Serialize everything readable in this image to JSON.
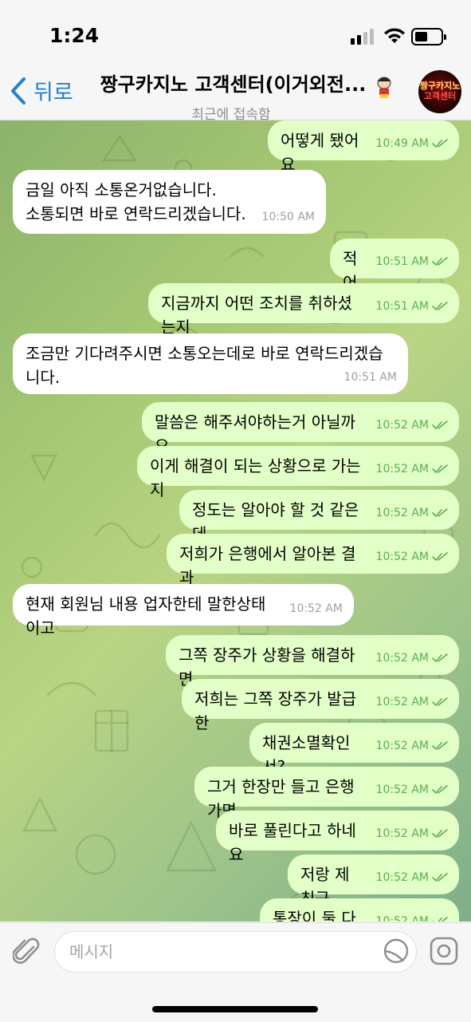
{
  "status": {
    "time": "1:24"
  },
  "header": {
    "back_label": "뒤로",
    "title": "짱구카지노 고객센터(이거외전...",
    "subtitle": "최근에 접속함",
    "avatar_line1": "짱구카지노",
    "avatar_line2": "고객센터"
  },
  "messages": [
    {
      "dir": "out",
      "text": "어떻게 됐어요",
      "time": "10:49 AM"
    },
    {
      "dir": "in",
      "text": "금일 아직 소통온거없습니다.\n소통되면 바로 연락드리겠습니다.",
      "time": "10:50 AM"
    },
    {
      "dir": "out",
      "text": "적어도",
      "time": "10:51 AM"
    },
    {
      "dir": "out",
      "text": "지금까지 어떤 조치를 취하셨는지",
      "time": "10:51 AM"
    },
    {
      "dir": "in",
      "text": "조금만 기다려주시면 소통오는데로 바로 연락드리겠습\n니다.",
      "time": "10:51 AM"
    },
    {
      "dir": "out",
      "text": "말씀은 해주셔야하는거 아닐까요",
      "time": "10:52 AM"
    },
    {
      "dir": "out",
      "text": "이게 해결이 되는 상황으로 가는지",
      "time": "10:52 AM"
    },
    {
      "dir": "out",
      "text": "정도는 알아야 할 것 같은데",
      "time": "10:52 AM"
    },
    {
      "dir": "out",
      "text": "저희가 은행에서 알아본 결과",
      "time": "10:52 AM"
    },
    {
      "dir": "in",
      "text": "현재 회원님 내용 업자한테 말한상태이고",
      "time": "10:52 AM"
    },
    {
      "dir": "out",
      "text": "그쪽 장주가 상황을 해결하면",
      "time": "10:52 AM"
    },
    {
      "dir": "out",
      "text": "저희는 그쪽 장주가 발급한",
      "time": "10:52 AM"
    },
    {
      "dir": "out",
      "text": "채권소멸확인서?",
      "time": "10:52 AM"
    },
    {
      "dir": "out",
      "text": "그거 한장만 들고 은행가면",
      "time": "10:52 AM"
    },
    {
      "dir": "out",
      "text": "바로 풀린다고 하네요",
      "time": "10:52 AM"
    },
    {
      "dir": "out",
      "text": "저랑 제 친구",
      "time": "10:52 AM"
    },
    {
      "dir": "out",
      "text": "통장이 둘 다 묶였는데",
      "time": "10:52 AM"
    }
  ],
  "composer": {
    "placeholder": "메시지"
  },
  "colors": {
    "accent": "#2481cc",
    "outgoing": "#e2ffc7",
    "incoming": "#ffffff",
    "check": "#5aad4f"
  }
}
